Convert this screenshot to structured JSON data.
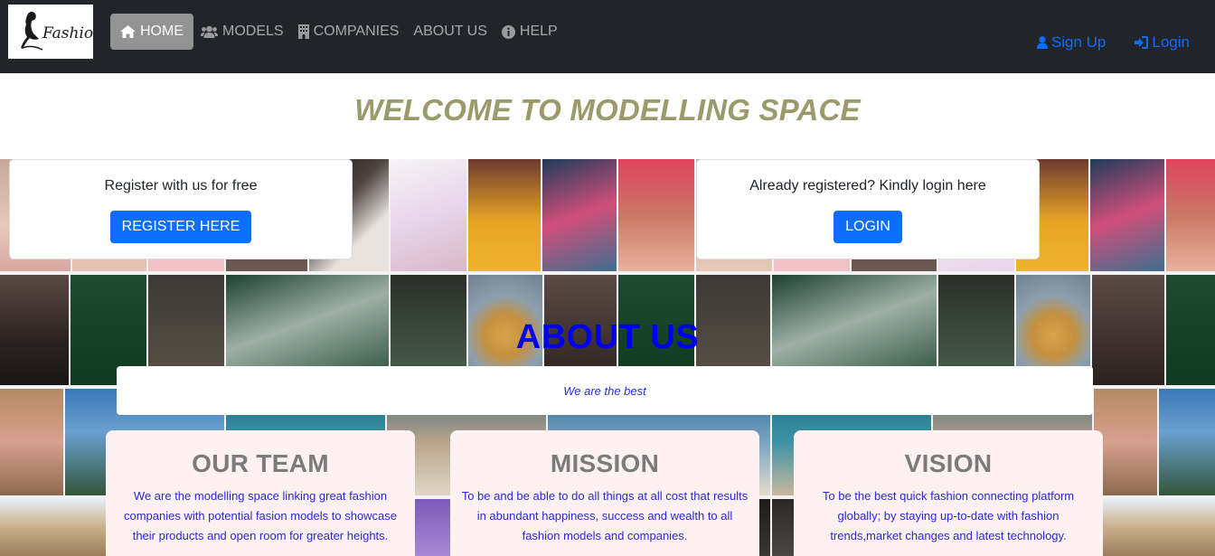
{
  "navbar": {
    "logo_text": "Fashion",
    "items": [
      {
        "label": "HOME",
        "icon": "home-icon",
        "active": true
      },
      {
        "label": "MODELS",
        "icon": "users-icon",
        "active": false
      },
      {
        "label": "COMPANIES",
        "icon": "building-icon",
        "active": false
      },
      {
        "label": "ABOUT US",
        "icon": "",
        "active": false
      },
      {
        "label": "HELP",
        "icon": "info-circle-icon",
        "active": false
      }
    ],
    "signup_label": "Sign Up",
    "login_label": "Login"
  },
  "welcome": {
    "title": "WELCOME TO MODELLING SPACE"
  },
  "register_card": {
    "text": "Register with us for free",
    "button_label": "REGISTER HERE"
  },
  "login_card": {
    "text": "Already registered? Kindly login here",
    "button_label": "LOGIN"
  },
  "about": {
    "title": "ABOUT US",
    "tagline": "We are the best"
  },
  "features": [
    {
      "title": "OUR TEAM",
      "text": "We are the modelling space linking great fashion companies with potential fasion models to showcase their products and open room for greater heights."
    },
    {
      "title": "MISSION",
      "text": "To be and be able to do all things at all cost that results in abundant happiness, success and wealth to all fashion models and companies."
    },
    {
      "title": "VISION",
      "text": "To be the best quick fashion connecting platform globally; by staying up-to-date with fashion trends,market changes and latest technology."
    }
  ],
  "colors": {
    "navbar_bg": "#212529",
    "accent": "#0d6efd",
    "welcome_title": "#9b9a6a",
    "about_title": "#0000f0",
    "feature_bg": "#fdf1f1"
  }
}
